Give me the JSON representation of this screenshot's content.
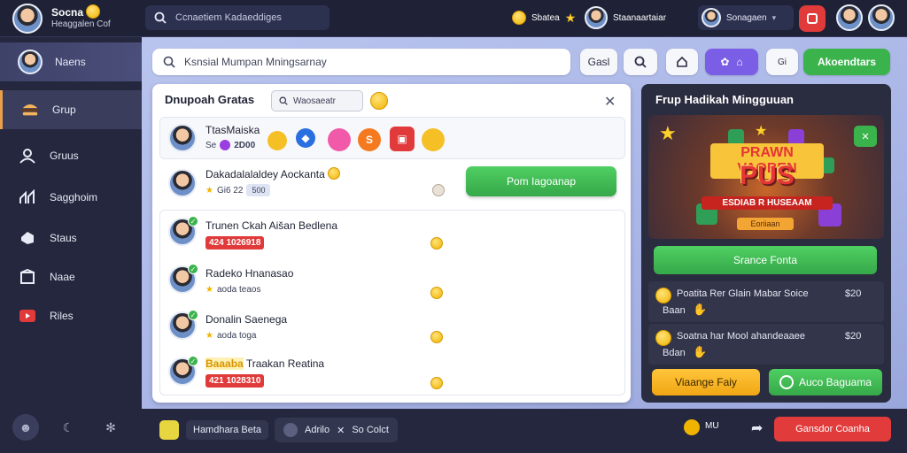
{
  "topbar": {
    "brand_title": "Socna",
    "brand_sub": "Heaggalen Cof",
    "search_text": "Ccnaetiem Kadaeddiges",
    "chip_status": "Sbatea",
    "chip_user": "Staanaartaiar",
    "user_label": "Sonagaen"
  },
  "sidebar": {
    "items": [
      {
        "label": "Naens",
        "icon": "avatar-icon"
      },
      {
        "label": "Grup",
        "icon": "burger-icon"
      },
      {
        "label": "Gruus",
        "icon": "users-icon"
      },
      {
        "label": "Sagghoim",
        "icon": "chart-icon"
      },
      {
        "label": "Staus",
        "icon": "tag-icon"
      },
      {
        "label": "Naae",
        "icon": "box-icon"
      },
      {
        "label": "Riles",
        "icon": "video-icon"
      }
    ]
  },
  "toolbar": {
    "search_text": "Ksnsial Mumpan Mningsarnay",
    "btn_search_label": "Gasl",
    "btn_list_label": "Gi",
    "btn_green_label": "Akoendtars"
  },
  "group_panel": {
    "title": "Dnupoah Gratas",
    "tag_label": "Waosaeatr",
    "top_member": {
      "name": "TtasMaiska",
      "meta": "2D00"
    },
    "second_member": {
      "name": "Dakadalalaldey Aockanta",
      "tag": "Gi6 22",
      "badge": "500"
    },
    "join_button": "Pom Iagoanap",
    "members": [
      {
        "name": "Trunen Ckah Aišan Bedlena",
        "tag": "424 1026918",
        "tag_type": "red"
      },
      {
        "name": "Radeko Hnanasao",
        "tag": "aoda teaos",
        "tag_type": "plain"
      },
      {
        "name": "Donalin Saenega",
        "tag": "aoda toga",
        "tag_type": "plain"
      },
      {
        "name": "Traakan Reatina",
        "prefix": "Baaaba",
        "tag": "421 1028310",
        "tag_type": "red"
      }
    ]
  },
  "weekly_panel": {
    "title": "Frup Hadikah Mingguuan",
    "promo_line1": "PRAWN VAOBEN",
    "promo_line2": "PUS",
    "promo_line3": "ESDIAB R HUSEAAM",
    "promo_line4": "Eoriiaan",
    "claim_button": "Srance Fonta",
    "rows": [
      {
        "title": "Poatita Rer Glain Mabar Soice",
        "sub": "Baan",
        "amount": "$20"
      },
      {
        "title": "Soatna har Mool ahandeaaee",
        "sub": "Bdan",
        "amount": "$20"
      }
    ],
    "btn_yellow": "Viaange Faiy",
    "btn_green": "Auco Baguama"
  },
  "bottombar": {
    "chip1": "Hamdhara Beta",
    "chip2a": "Adrilo",
    "chip2b": "So Colct",
    "mini_label": "MU",
    "red_button": "Gansdor Coanha"
  },
  "colors": {
    "accent_green": "#3bb34d",
    "accent_red": "#e13a3a",
    "accent_purple": "#7a5fe6",
    "accent_yellow": "#f1a613"
  }
}
